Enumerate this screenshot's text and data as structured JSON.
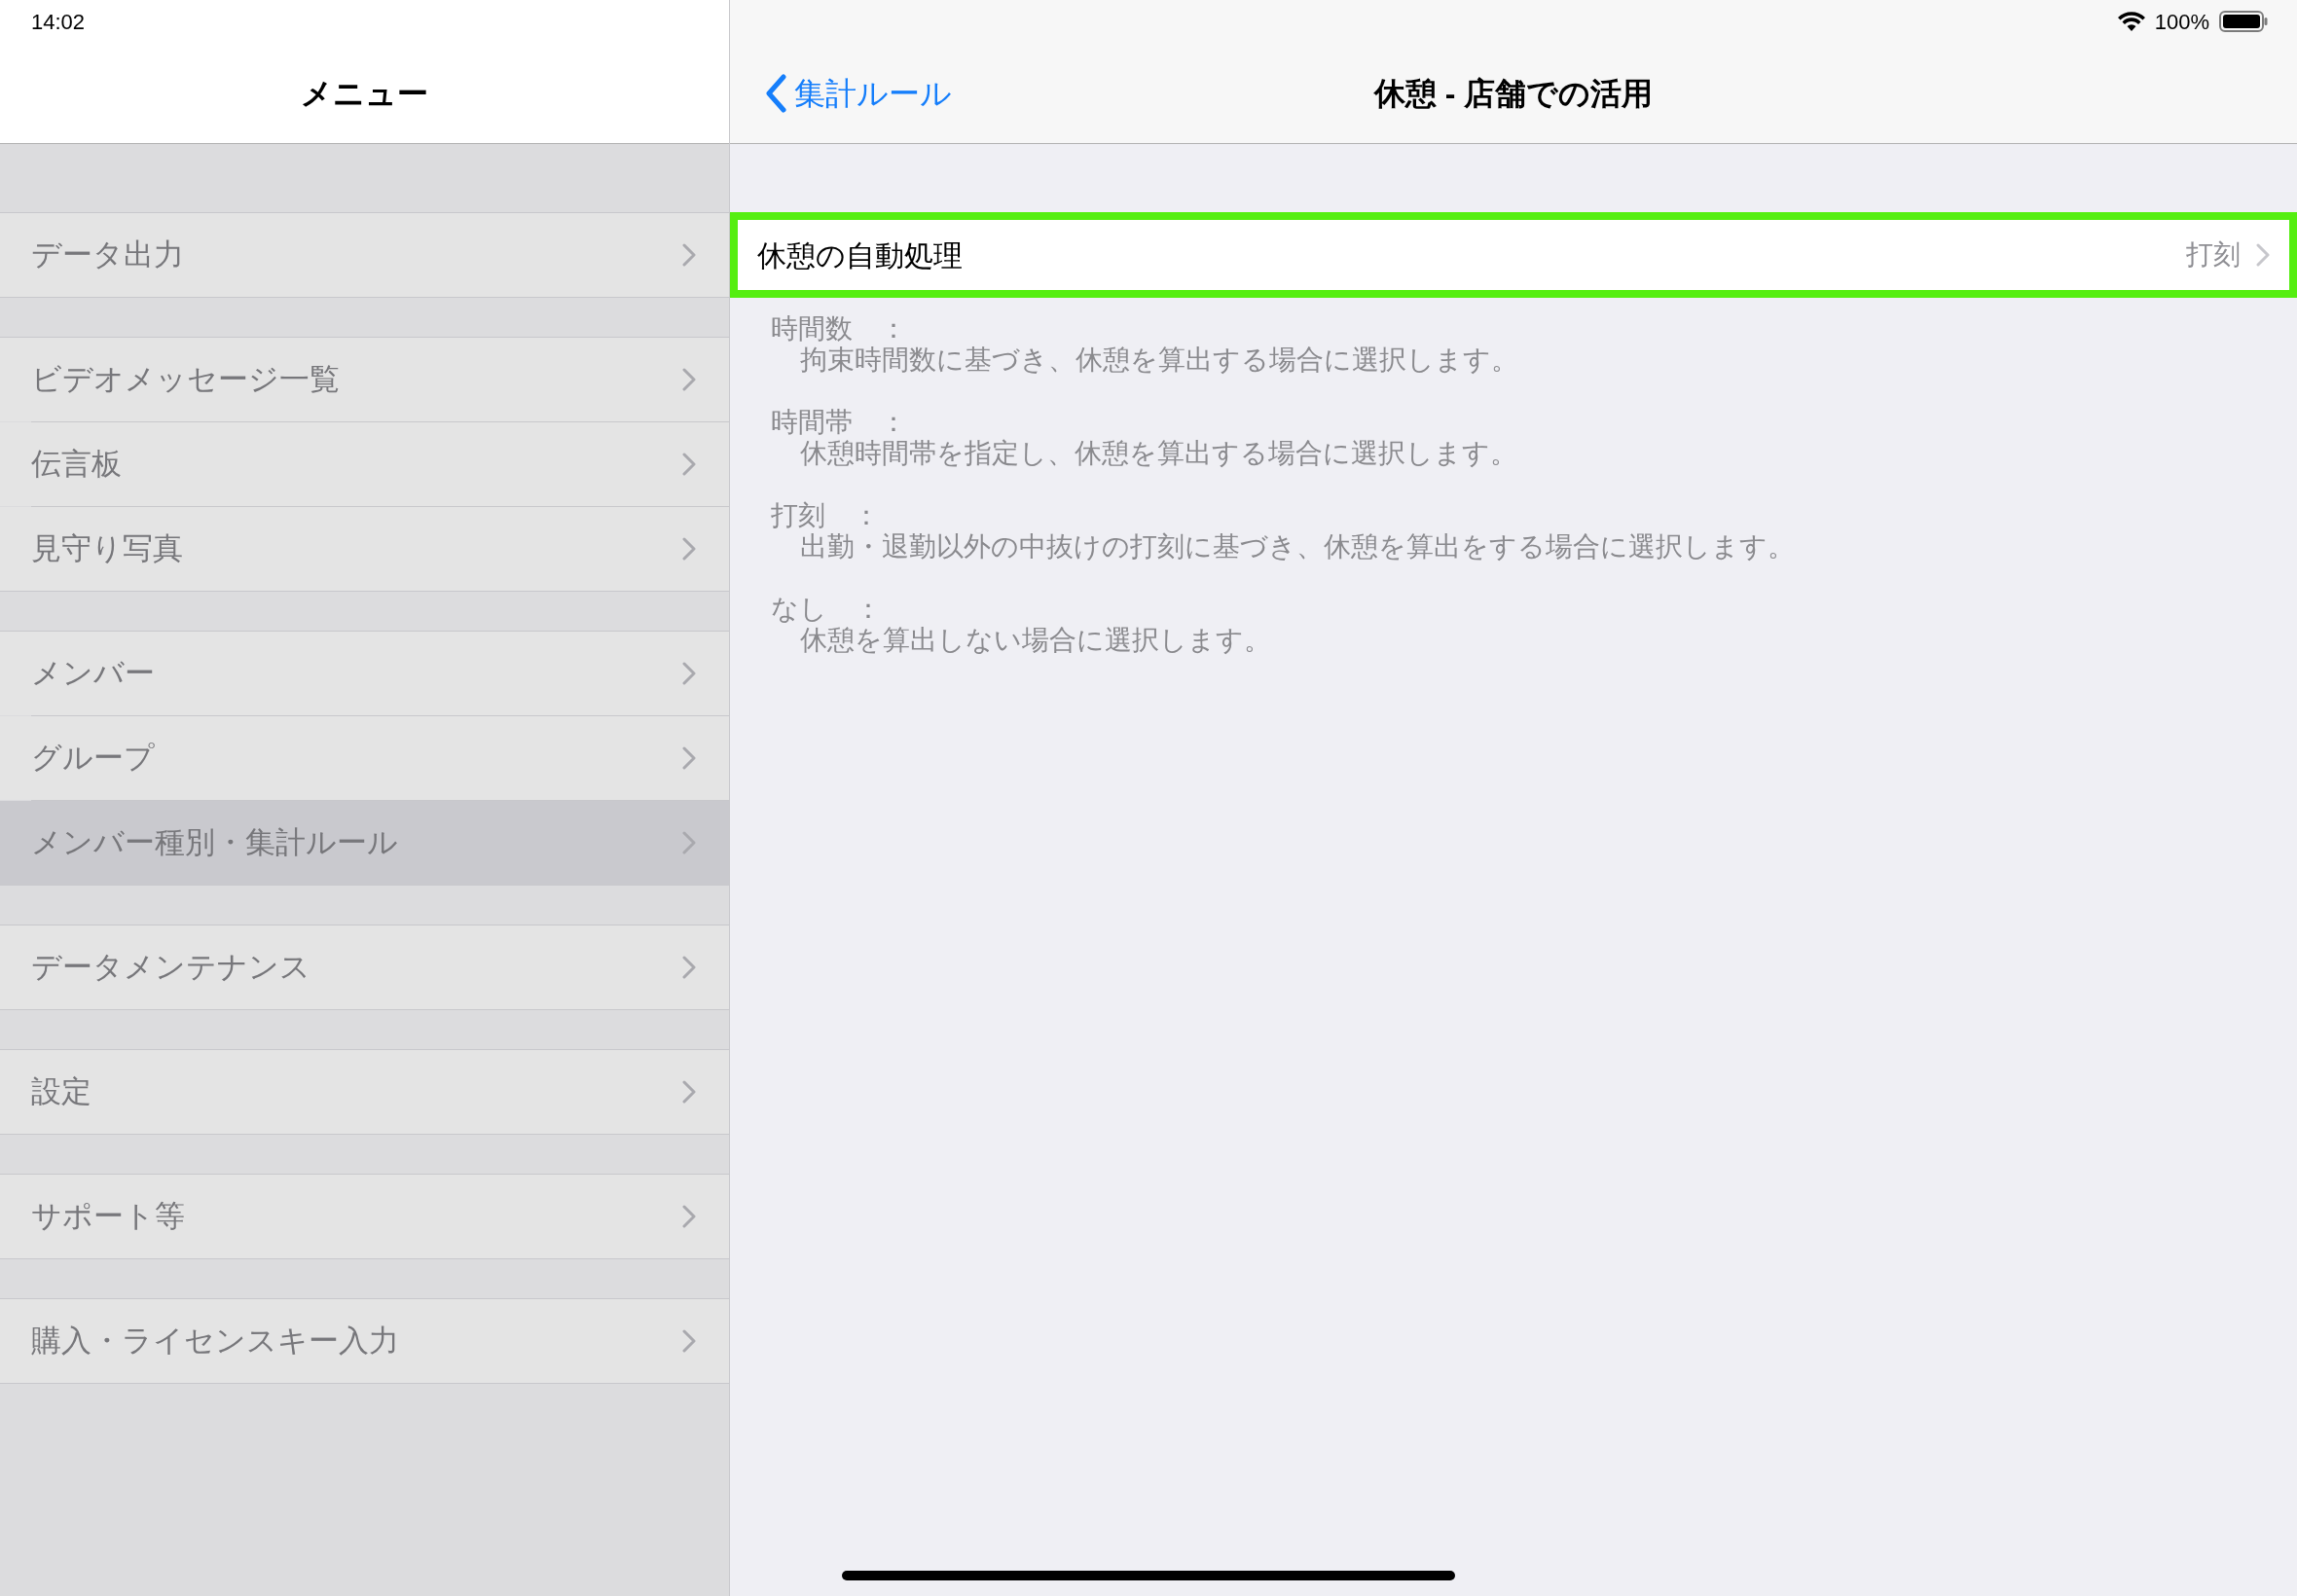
{
  "status_bar": {
    "time": "14:02",
    "battery": "100%"
  },
  "sidebar": {
    "title": "メニュー",
    "groups": [
      {
        "items": [
          {
            "label": "データ出力",
            "selected": false
          }
        ]
      },
      {
        "items": [
          {
            "label": "ビデオメッセージ一覧",
            "selected": false
          },
          {
            "label": "伝言板",
            "selected": false
          },
          {
            "label": "見守り写真",
            "selected": false
          }
        ]
      },
      {
        "items": [
          {
            "label": "メンバー",
            "selected": false
          },
          {
            "label": "グループ",
            "selected": false
          },
          {
            "label": "メンバー種別・集計ルール",
            "selected": true
          }
        ]
      },
      {
        "items": [
          {
            "label": "データメンテナンス",
            "selected": false
          }
        ]
      },
      {
        "items": [
          {
            "label": "設定",
            "selected": false
          }
        ]
      },
      {
        "items": [
          {
            "label": "サポート等",
            "selected": false
          }
        ]
      },
      {
        "items": [
          {
            "label": "購入・ライセンスキー入力",
            "selected": false
          }
        ]
      }
    ]
  },
  "detail": {
    "back_label": "集計ルール",
    "title": "休憩 - 店舗での活用",
    "setting_row": {
      "label": "休憩の自動処理",
      "value": "打刻",
      "highlighted": true
    },
    "descriptions": [
      {
        "term": "時間数　：",
        "text": "拘束時間数に基づき、休憩を算出する場合に選択します。"
      },
      {
        "term": "時間帯　：",
        "text": "休憩時間帯を指定し、休憩を算出する場合に選択します。"
      },
      {
        "term": "打刻　：",
        "text": "出勤・退勤以外の中抜けの打刻に基づき、休憩を算出をする場合に選択します。"
      },
      {
        "term": "なし　：",
        "text": "休憩を算出しない場合に選択します。"
      }
    ]
  }
}
